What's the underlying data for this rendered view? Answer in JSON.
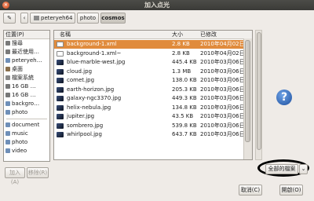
{
  "window": {
    "title": "加入点光"
  },
  "pathbar": {
    "crumbs": [
      "peteryeh64",
      "photo",
      "cosmos"
    ]
  },
  "sidebar": {
    "header": "位置(P)",
    "items": [
      {
        "label": "搜尋",
        "color": "#7a7a7a"
      },
      {
        "label": "最近使用…",
        "color": "#7a7a7a"
      },
      {
        "label": "peteryeh…",
        "color": "#6f8fb8"
      },
      {
        "label": "桌面",
        "color": "#8a6f4c"
      },
      {
        "label": "檔案系統",
        "color": "#888888"
      },
      {
        "label": "16 GB …",
        "color": "#777777"
      },
      {
        "label": "16 GB …",
        "color": "#777777"
      },
      {
        "label": "backgro…",
        "color": "#6f8fb8"
      },
      {
        "label": "photo",
        "color": "#6f8fb8"
      }
    ],
    "items2": [
      {
        "label": "document",
        "color": "#6f8fb8"
      },
      {
        "label": "music",
        "color": "#6f8fb8"
      },
      {
        "label": "photo",
        "color": "#6f8fb8"
      },
      {
        "label": "video",
        "color": "#6f8fb8"
      }
    ],
    "add_label": "加入(A)",
    "remove_label": "移除(R)"
  },
  "filelist": {
    "columns": {
      "name": "名稱",
      "size": "大小",
      "modified": "已修改"
    },
    "rows": [
      {
        "name": "background-1.xml",
        "size": "2.8 KB",
        "modified": "2010年04月02日",
        "icon": "doc-icon"
      },
      {
        "name": "background-1.xml~",
        "size": "2.8 KB",
        "modified": "2010年04月02日",
        "icon": "doc-icon"
      },
      {
        "name": "blue-marble-west.jpg",
        "size": "445.4 KB",
        "modified": "2010年03月06日",
        "icon": "image-icon"
      },
      {
        "name": "cloud.jpg",
        "size": "1.3 MB",
        "modified": "2010年03月06日",
        "icon": "image-icon"
      },
      {
        "name": "comet.jpg",
        "size": "138.0 KB",
        "modified": "2010年03月06日",
        "icon": "image-icon"
      },
      {
        "name": "earth-horizon.jpg",
        "size": "205.3 KB",
        "modified": "2010年03月06日",
        "icon": "image-icon"
      },
      {
        "name": "galaxy-ngc3370.jpg",
        "size": "449.3 KB",
        "modified": "2010年03月06日",
        "icon": "image-icon"
      },
      {
        "name": "helix-nebula.jpg",
        "size": "134.8 KB",
        "modified": "2010年03月06日",
        "icon": "image-icon"
      },
      {
        "name": "jupiter.jpg",
        "size": "43.5 KB",
        "modified": "2010年03月06日",
        "icon": "image-icon"
      },
      {
        "name": "sombrero.jpg",
        "size": "539.8 KB",
        "modified": "2010年03月06日",
        "icon": "image-icon"
      },
      {
        "name": "whirlpool.jpg",
        "size": "643.7 KB",
        "modified": "2010年03月06日",
        "icon": "image-icon"
      }
    ],
    "selected_index": 0
  },
  "filter": {
    "value": "全部的檔案"
  },
  "actions": {
    "cancel_label": "取消(C)",
    "open_label": "開啟(O)"
  },
  "colors": {
    "selection": "#e08b3c",
    "preview": "#2a64b8"
  }
}
